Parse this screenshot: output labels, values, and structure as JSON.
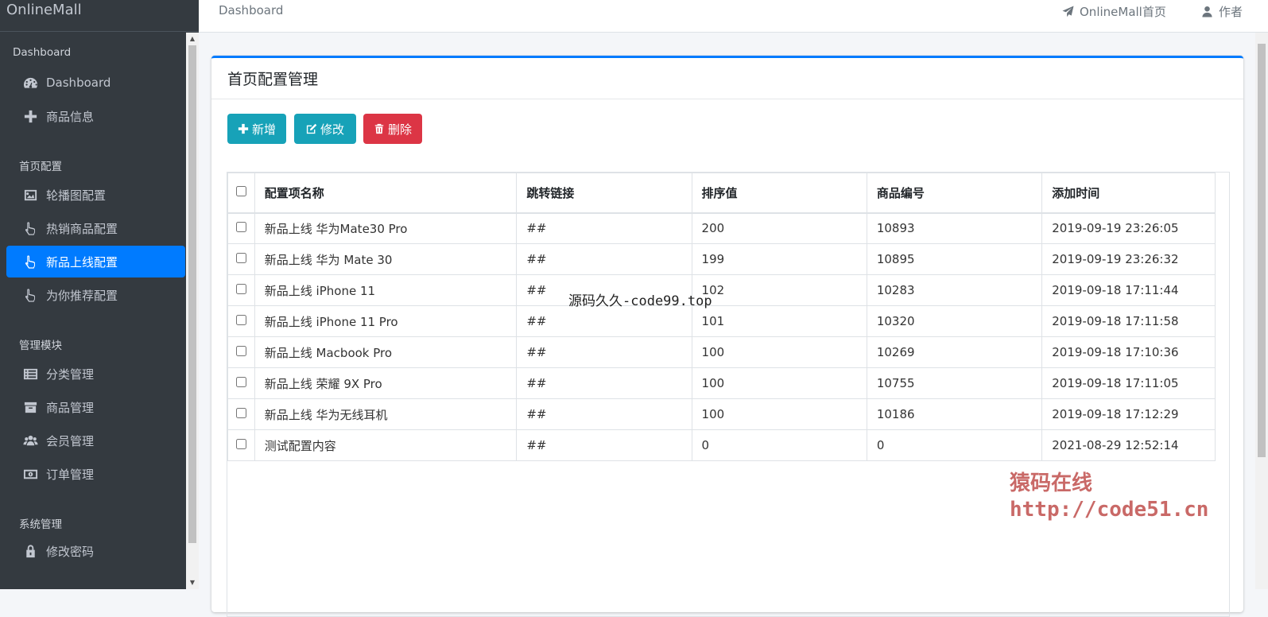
{
  "brand": "OnlineMall",
  "topbar": {
    "breadcrumb": "Dashboard",
    "home_link": "OnlineMall首页",
    "author_link": "作者"
  },
  "sidebar": {
    "sections": [
      "Dashboard",
      "首页配置",
      "管理模块",
      "系统管理"
    ],
    "items": [
      {
        "label": "Dashboard",
        "icon": "dashboard-icon"
      },
      {
        "label": "商品信息",
        "icon": "plus-icon"
      },
      {
        "label": "轮播图配置",
        "icon": "image-icon"
      },
      {
        "label": "热销商品配置",
        "icon": "hand-pointer-icon"
      },
      {
        "label": "新品上线配置",
        "icon": "hand-pointer-icon",
        "active": true
      },
      {
        "label": "为你推荐配置",
        "icon": "hand-pointer-icon"
      },
      {
        "label": "分类管理",
        "icon": "list-icon"
      },
      {
        "label": "商品管理",
        "icon": "archive-icon"
      },
      {
        "label": "会员管理",
        "icon": "users-icon"
      },
      {
        "label": "订单管理",
        "icon": "money-icon"
      },
      {
        "label": "修改密码",
        "icon": "lock-icon"
      }
    ]
  },
  "card": {
    "title": "首页配置管理",
    "buttons": {
      "add": "新增",
      "edit": "修改",
      "delete": "删除"
    }
  },
  "table": {
    "columns": [
      "配置项名称",
      "跳转链接",
      "排序值",
      "商品编号",
      "添加时间"
    ],
    "rows": [
      [
        "新品上线 华为Mate30 Pro",
        "##",
        "200",
        "10893",
        "2019-09-19 23:26:05"
      ],
      [
        "新品上线 华为 Mate 30",
        "##",
        "199",
        "10895",
        "2019-09-19 23:26:32"
      ],
      [
        "新品上线 iPhone 11",
        "##",
        "102",
        "10283",
        "2019-09-18 17:11:44"
      ],
      [
        "新品上线 iPhone 11 Pro",
        "##",
        "101",
        "10320",
        "2019-09-18 17:11:58"
      ],
      [
        "新品上线 Macbook Pro",
        "##",
        "100",
        "10269",
        "2019-09-18 17:10:36"
      ],
      [
        "新品上线 荣耀 9X Pro",
        "##",
        "100",
        "10755",
        "2019-09-18 17:11:05"
      ],
      [
        "新品上线 华为无线耳机",
        "##",
        "100",
        "10186",
        "2019-09-18 17:12:29"
      ],
      [
        "测试配置内容",
        "##",
        "0",
        "0",
        "2021-08-29 12:52:14"
      ]
    ]
  },
  "watermarks": {
    "center": "源码久久-code99.top",
    "corner_line1": "猿码在线",
    "corner_line2": "http://code51.cn"
  },
  "colors": {
    "primary": "#007bff",
    "info": "#17a2b8",
    "danger": "#dc3545",
    "sidebar": "#343a40"
  }
}
